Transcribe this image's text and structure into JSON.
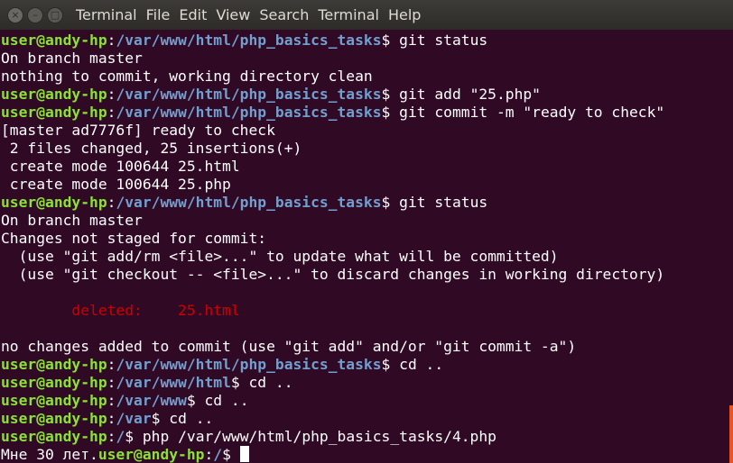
{
  "menubar": {
    "close_glyph": "×",
    "minimize_glyph": "–",
    "maximize_glyph": "□",
    "items": [
      "Terminal",
      "File",
      "Edit",
      "View",
      "Search",
      "Terminal",
      "Help"
    ]
  },
  "prompt": {
    "user_host": "user@andy-hp",
    "colon": ":",
    "dollar": "$"
  },
  "lines": [
    {
      "path": "/var/www/html/php_basics_tasks",
      "cmd": " git status"
    },
    {
      "text": "On branch master"
    },
    {
      "text": "nothing to commit, working directory clean"
    },
    {
      "path": "/var/www/html/php_basics_tasks",
      "cmd": " git add \"25.php\""
    },
    {
      "path": "/var/www/html/php_basics_tasks",
      "cmd": " git commit -m \"ready to check\""
    },
    {
      "text": "[master ad7776f] ready to check"
    },
    {
      "text": " 2 files changed, 25 insertions(+)"
    },
    {
      "text": " create mode 100644 25.html"
    },
    {
      "text": " create mode 100644 25.php"
    },
    {
      "path": "/var/www/html/php_basics_tasks",
      "cmd": " git status"
    },
    {
      "text": "On branch master"
    },
    {
      "text": "Changes not staged for commit:"
    },
    {
      "text": "  (use \"git add/rm <file>...\" to update what will be committed)"
    },
    {
      "text": "  (use \"git checkout -- <file>...\" to discard changes in working directory)"
    },
    {
      "text": ""
    },
    {
      "red": "        deleted:    25.html"
    },
    {
      "text": ""
    },
    {
      "text": "no changes added to commit (use \"git add\" and/or \"git commit -a\")"
    },
    {
      "path": "/var/www/html/php_basics_tasks",
      "cmd": " cd .."
    },
    {
      "path": "/var/www/html",
      "cmd": " cd .."
    },
    {
      "path": "/var/www",
      "cmd": " cd .."
    },
    {
      "path": "/var",
      "cmd": " cd .."
    },
    {
      "path": "/",
      "cmd": " php /var/www/html/php_basics_tasks/4.php"
    },
    {
      "prefix": "Мне 30 лет.",
      "path": "/",
      "cmd": " ",
      "cursor": true
    }
  ],
  "colors": {
    "background": "#300a24",
    "user_host": "#8ae234",
    "path": "#729fcf",
    "deleted": "#cc0000",
    "scrollbar": "#e95420"
  }
}
